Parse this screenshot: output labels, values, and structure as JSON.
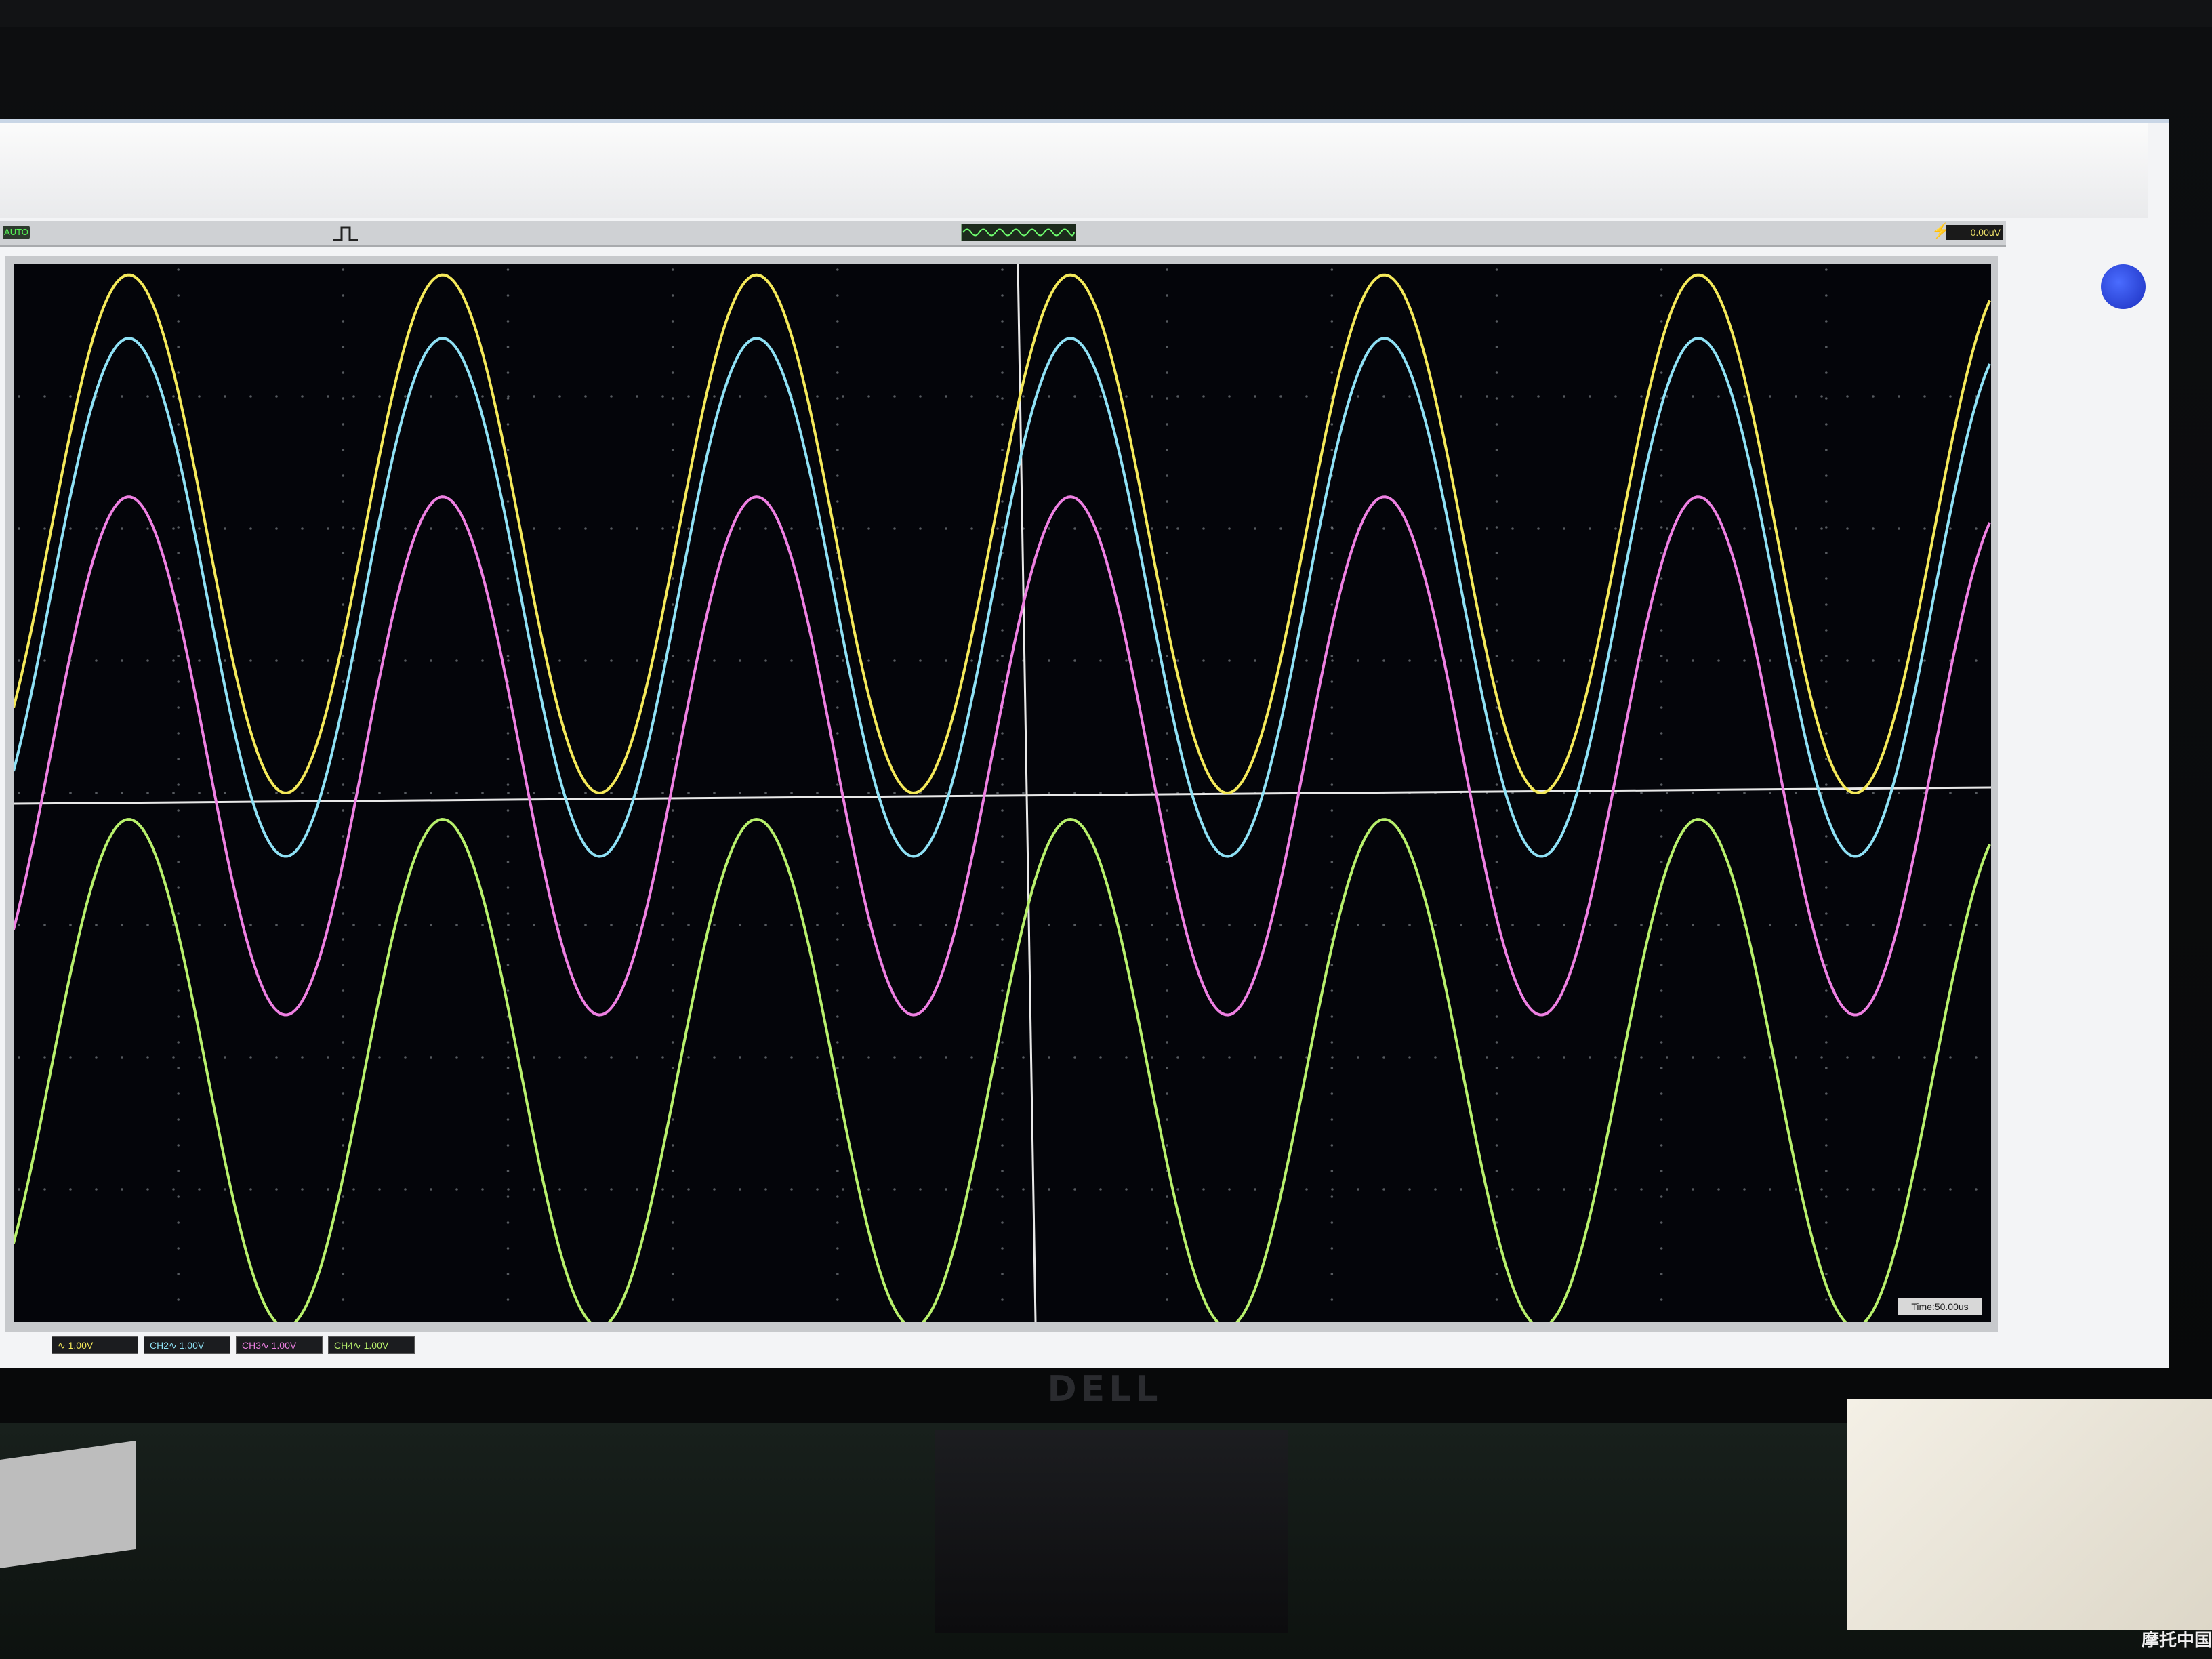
{
  "scope": {
    "run_state": "AUTO",
    "trigger_level": "0.00uV",
    "time_base": "Time:50.00us",
    "channels": [
      {
        "label": "CH1",
        "scale": "1.00V",
        "color": "#f4e95a",
        "visible_text": "∿ 1.00V"
      },
      {
        "label": "CH2",
        "scale": "1.00V",
        "color": "#8fe1f5",
        "visible_text": "CH2∿ 1.00V"
      },
      {
        "label": "CH3",
        "scale": "1.00V",
        "color": "#ee80e2",
        "visible_text": "CH3∿ 1.00V"
      },
      {
        "label": "CH4",
        "scale": "1.00V",
        "color": "#b8f06c",
        "visible_text": "CH4∿ 1.00V"
      }
    ],
    "trigger_edge_icon": "rising-edge-icon",
    "trigger_position_icon": "pulse-icon"
  },
  "monitor": {
    "brand": "DELL"
  },
  "watermark": "摩托中国",
  "colors": {
    "grid_dot": "#9aa0a6",
    "axis": "#e8e8e8",
    "background": "#04050a"
  }
}
